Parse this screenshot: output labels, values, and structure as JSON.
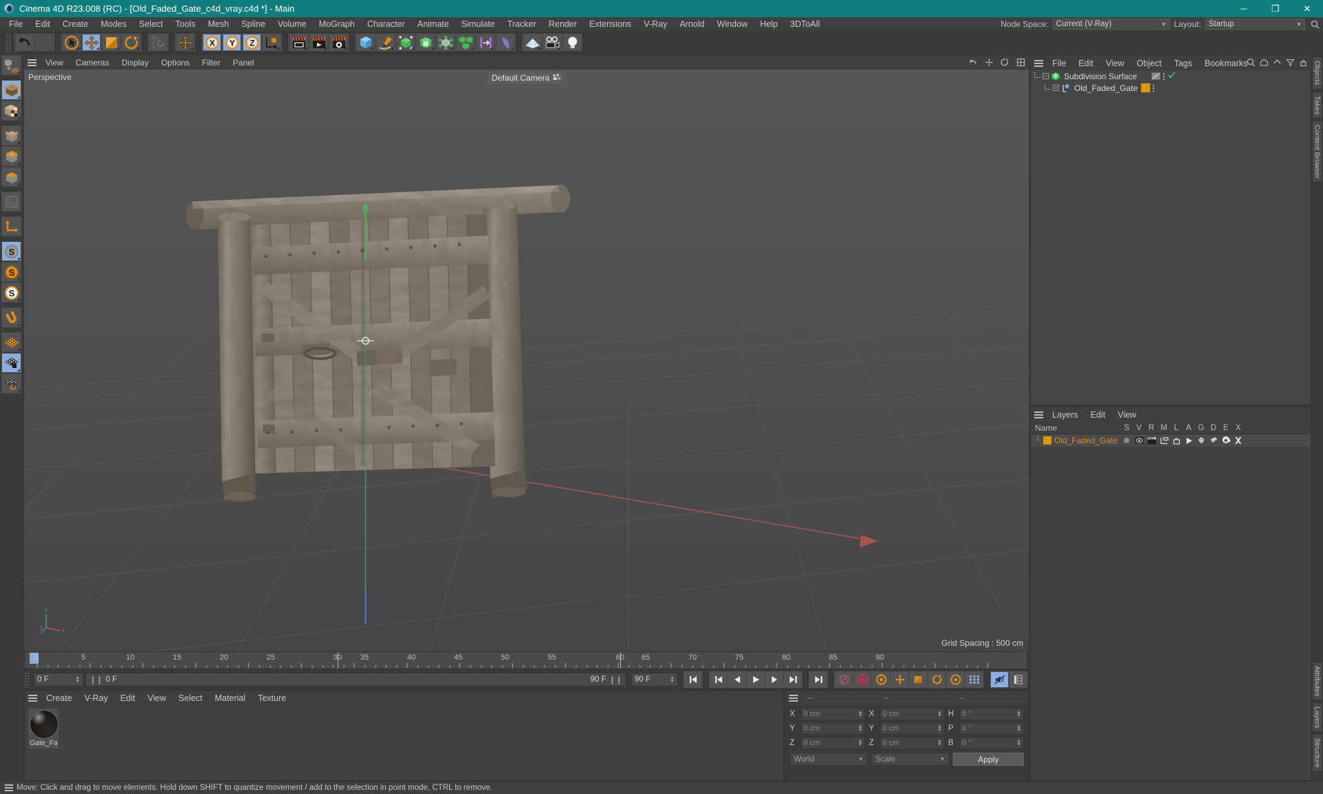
{
  "window": {
    "title": "Cinema 4D R23.008 (RC) - [Old_Faded_Gate_c4d_vray.c4d *] - Main",
    "minimize": "─",
    "maximize": "❐",
    "close": "✕"
  },
  "menubar": {
    "items": [
      "File",
      "Edit",
      "Create",
      "Modes",
      "Select",
      "Tools",
      "Mesh",
      "Spline",
      "Volume",
      "MoGraph",
      "Character",
      "Animate",
      "Simulate",
      "Tracker",
      "Render",
      "Extensions",
      "V-Ray",
      "Arnold",
      "Window",
      "Help",
      "3DToAll"
    ],
    "node_space_label": "Node Space:",
    "node_space_value": "Current (V-Ray)",
    "layout_label": "Layout:",
    "layout_value": "Startup",
    "search_icon": "search-icon"
  },
  "toolbar": {
    "groups": [
      {
        "name": "history",
        "buttons": [
          {
            "name": "undo-button",
            "icon": "undo-icon",
            "active": false,
            "disabled": false
          },
          {
            "name": "redo-button",
            "icon": "redo-icon",
            "active": false,
            "disabled": true
          }
        ]
      },
      {
        "name": "transform",
        "buttons": [
          {
            "name": "select-tool-button",
            "icon": "select-icon",
            "active": false,
            "disabled": false
          },
          {
            "name": "move-tool-button",
            "icon": "move-icon",
            "active": true,
            "disabled": false
          },
          {
            "name": "scale-tool-button",
            "icon": "scale-icon",
            "active": false,
            "disabled": false
          },
          {
            "name": "rotate-tool-button",
            "icon": "rotate-icon",
            "active": false,
            "disabled": false
          }
        ]
      },
      {
        "name": "psr",
        "buttons": [
          {
            "name": "psr-button",
            "icon": "psr-icon",
            "active": false,
            "disabled": false
          }
        ]
      },
      {
        "name": "world-axis",
        "buttons": [
          {
            "name": "world-axis-button",
            "icon": "move-icon",
            "active": false,
            "disabled": false
          }
        ]
      },
      {
        "name": "axis-locks",
        "buttons": [
          {
            "name": "lock-x-button",
            "icon": "x-axis-icon",
            "active": true,
            "disabled": false
          },
          {
            "name": "lock-y-button",
            "icon": "y-axis-icon",
            "active": true,
            "disabled": false
          },
          {
            "name": "lock-z-button",
            "icon": "z-axis-icon",
            "active": true,
            "disabled": false
          },
          {
            "name": "coordinate-system-button",
            "icon": "world-coords-icon",
            "active": false,
            "disabled": false
          }
        ]
      },
      {
        "name": "render",
        "buttons": [
          {
            "name": "render-view-button",
            "icon": "render-view-icon",
            "active": false,
            "disabled": false
          },
          {
            "name": "render-queue-button",
            "icon": "render-picture-icon",
            "active": false,
            "disabled": false
          },
          {
            "name": "render-settings-button",
            "icon": "render-settings-icon",
            "active": false,
            "disabled": false
          }
        ]
      },
      {
        "name": "create",
        "buttons": [
          {
            "name": "add-cube-button",
            "icon": "cube-icon",
            "active": false,
            "disabled": false
          },
          {
            "name": "add-spline-button",
            "icon": "pen-spline-icon",
            "active": false,
            "disabled": false
          },
          {
            "name": "add-generator-button",
            "icon": "generator-icon",
            "active": false,
            "disabled": false
          },
          {
            "name": "add-subdivision-button",
            "icon": "subdivision-icon",
            "active": false,
            "disabled": false
          },
          {
            "name": "add-deformer-button",
            "icon": "deformer-icon",
            "active": false,
            "disabled": false
          },
          {
            "name": "add-mograph-button",
            "icon": "mograph-cloner-icon",
            "active": false,
            "disabled": false
          },
          {
            "name": "add-field-button",
            "icon": "field-icon",
            "active": false,
            "disabled": false
          },
          {
            "name": "add-cloth-button",
            "icon": "cloth-icon",
            "active": false,
            "disabled": false
          }
        ]
      },
      {
        "name": "scene",
        "buttons": [
          {
            "name": "add-floor-button",
            "icon": "floor-icon",
            "active": false,
            "disabled": false
          },
          {
            "name": "add-camera-button",
            "icon": "camera-icon",
            "active": false,
            "disabled": false
          },
          {
            "name": "add-light-button",
            "icon": "light-bulb-icon",
            "active": false,
            "disabled": false
          }
        ]
      }
    ]
  },
  "left_toolbar": {
    "buttons": [
      {
        "name": "make-editable-button",
        "icon": "make-editable-icon",
        "active": false,
        "gap_after": true
      },
      {
        "name": "model-mode-button",
        "icon": "model-mode-icon",
        "active": true,
        "gap_after": false
      },
      {
        "name": "texture-mode-button",
        "icon": "texture-mode-icon",
        "active": false,
        "gap_after": true
      },
      {
        "name": "points-mode-button",
        "icon": "points-mode-icon",
        "active": false,
        "gap_after": false
      },
      {
        "name": "edges-mode-button",
        "icon": "edges-mode-icon",
        "active": false,
        "gap_after": false
      },
      {
        "name": "polygons-mode-button",
        "icon": "polygons-mode-icon",
        "active": false,
        "gap_after": true
      },
      {
        "name": "uv-mode-button",
        "icon": "uv-mode-icon",
        "active": false,
        "gap_after": true
      },
      {
        "name": "axis-mode-button",
        "icon": "axis-mode-icon",
        "active": false,
        "gap_after": true
      },
      {
        "name": "enable-snapping-button",
        "icon": "snap-grey-icon",
        "active": true,
        "gap_after": false
      },
      {
        "name": "quantize-button",
        "icon": "snap-orange-icon",
        "active": false,
        "gap_after": false
      },
      {
        "name": "workplane-snap-button",
        "icon": "snap-ring-icon",
        "active": false,
        "gap_after": true
      },
      {
        "name": "magnet-button",
        "icon": "magnet-icon",
        "active": false,
        "gap_after": true
      },
      {
        "name": "workplane-button",
        "icon": "workplane-icon",
        "active": false,
        "gap_after": false
      },
      {
        "name": "lock-workplane-button",
        "icon": "workplane-lock-icon",
        "active": true,
        "gap_after": false
      },
      {
        "name": "planar-workplane-button",
        "icon": "workplane-rotate-icon",
        "active": false,
        "gap_after": false
      }
    ]
  },
  "viewport": {
    "menu": [
      "View",
      "Cameras",
      "Display",
      "Options",
      "Filter",
      "Panel"
    ],
    "label": "Perspective",
    "camera": "Default Camera",
    "camera_icon": "camera-dots-icon",
    "grid_spacing": "Grid Spacing : 500 cm",
    "axis_labels": {
      "x": "X",
      "y": "Y",
      "z": "Z"
    },
    "header_icons": [
      "undo-view-icon",
      "move-view-icon",
      "rotate-view-icon",
      "maximize-view-icon"
    ]
  },
  "timeline": {
    "tick_labels": [
      "0",
      "5",
      "10",
      "15",
      "20",
      "25",
      "30",
      "35",
      "40",
      "45",
      "50",
      "55",
      "60",
      "65",
      "70",
      "75",
      "80",
      "85",
      "90"
    ],
    "range_start": 0,
    "range_end": 90,
    "current_frame_field": "0 F",
    "current_frame_strip": "0 F",
    "end_frame_field": "90 F",
    "preview_end_field": "90 F",
    "playhead_frames": [
      30,
      60
    ],
    "buttons": [
      {
        "name": "go-to-start-button",
        "icon": "skip-start-icon",
        "active": false
      },
      {
        "name": "go-to-previous-key-button",
        "icon": "prev-key-icon",
        "active": false
      },
      {
        "name": "step-back-button",
        "icon": "step-back-icon",
        "active": false
      },
      {
        "name": "play-button",
        "icon": "play-icon",
        "active": false
      },
      {
        "name": "step-forward-button",
        "icon": "step-forward-icon",
        "active": false
      },
      {
        "name": "go-to-next-key-button",
        "icon": "next-key-icon",
        "active": false
      },
      {
        "name": "go-to-end-button",
        "icon": "skip-end-icon",
        "active": false
      },
      {
        "name": "record-active-objects-button",
        "icon": "record-disabled-icon",
        "active": false
      },
      {
        "name": "autokeying-button",
        "icon": "autokey-icon",
        "active": false
      },
      {
        "name": "keyframe-selection-button",
        "icon": "keyframe-selection-icon",
        "active": false
      },
      {
        "name": "position-key-button",
        "icon": "position-key-icon",
        "active": false
      },
      {
        "name": "rotation-key-button",
        "icon": "rotation-key-icon",
        "active": false
      },
      {
        "name": "scale-key-button",
        "icon": "scale-key-icon",
        "active": false
      },
      {
        "name": "parameter-key-button",
        "icon": "parameter-key-icon",
        "active": false
      },
      {
        "name": "point-level-animation-button",
        "icon": "pla-icon",
        "active": false
      },
      {
        "name": "sound-button",
        "icon": "sound-icon",
        "active": true
      },
      {
        "name": "timeline-options-button",
        "icon": "timeline-options-icon",
        "active": false
      }
    ]
  },
  "material_manager": {
    "menu": [
      "Create",
      "V-Ray",
      "Edit",
      "View",
      "Select",
      "Material",
      "Texture"
    ],
    "materials": [
      {
        "name": "Gate_Fac",
        "display": "Gate_Fac"
      }
    ]
  },
  "coordinate_manager": {
    "headers": [
      "--",
      "--",
      "--"
    ],
    "rows": [
      {
        "label_a": "X",
        "value_a": "0 cm",
        "label_b": "X",
        "value_b": "0 cm",
        "label_c": "H",
        "value_c": "0 °"
      },
      {
        "label_a": "Y",
        "value_a": "0 cm",
        "label_b": "Y",
        "value_b": "0 cm",
        "label_c": "P",
        "value_c": "0 °"
      },
      {
        "label_a": "Z",
        "value_a": "0 cm",
        "label_b": "Z",
        "value_b": "0 cm",
        "label_c": "B",
        "value_c": "0 °"
      }
    ],
    "system_select": "World",
    "mode_select": "Scale",
    "apply_button": "Apply"
  },
  "object_manager": {
    "menu": [
      "File",
      "Edit",
      "View",
      "Object",
      "Tags",
      "Bookmarks"
    ],
    "objects": [
      {
        "name": "Subdivision Surface",
        "icon": "subdivision-surface-icon",
        "depth": 0,
        "tag": "none",
        "check": true,
        "tag_color": "#8a8a8a"
      },
      {
        "name": "Old_Faded_Gate",
        "icon": "polygon-object-icon",
        "depth": 1,
        "tag": "material",
        "check": false,
        "tag_color": "#d99a10"
      }
    ],
    "header_icons": [
      "search-icon",
      "home-icon",
      "up-icon",
      "filter-icon",
      "lock-icon"
    ]
  },
  "layer_manager": {
    "menu": [
      "Layers",
      "Edit",
      "View"
    ],
    "columns": [
      "Name",
      "S",
      "V",
      "R",
      "M",
      "L",
      "A",
      "G",
      "D",
      "E",
      "X"
    ],
    "rows": [
      {
        "name": "Old_Faded_Gate",
        "color": "#d99a10",
        "cells": [
          "solo-dot-icon",
          "view-eye-icon",
          "render-film-icon",
          "manager-icon",
          "lock-icon",
          "animation-play-icon",
          "generator-icon",
          "deformer-icon",
          "expression-icon",
          "xref-icon"
        ]
      }
    ]
  },
  "right_rail": {
    "tabs": [
      "Objects",
      "Takes",
      "Content Browser",
      "Attributes",
      "Layers",
      "Structure"
    ]
  },
  "statusbar": {
    "message": "Move: Click and drag to move elements. Hold down SHIFT to quantize movement / add to the selection in point mode, CTRL to remove."
  },
  "colors": {
    "accent_teal": "#127d7d",
    "active_blue": "#8caddc",
    "orange": "#d98a3a",
    "layer_yellow": "#d99a10"
  }
}
